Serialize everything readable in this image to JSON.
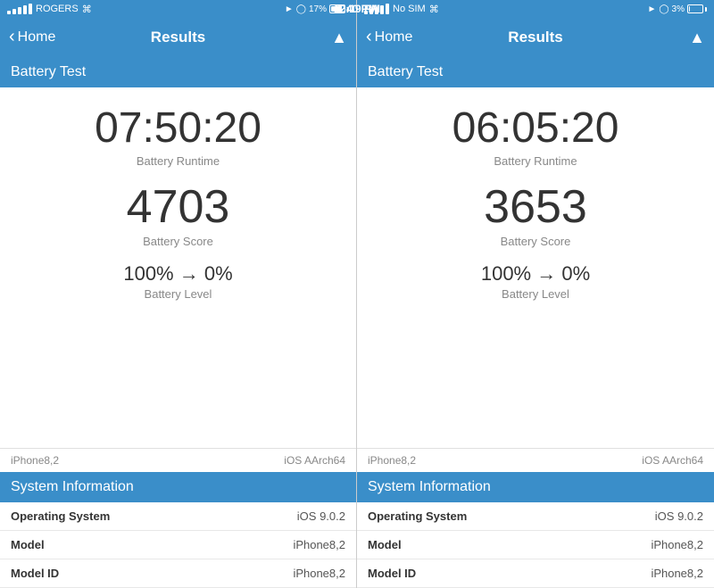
{
  "panels": [
    {
      "id": "panel-left",
      "statusBar": {
        "carrier": "ROGERS",
        "wifi": true,
        "time": "1:40 PM",
        "location": true,
        "bluetooth": true,
        "battery_percent": "17%",
        "battery_fill_width": "17%"
      },
      "nav": {
        "back_label": "Home",
        "title": "Results"
      },
      "section_title": "Battery Test",
      "runtime": "07:50:20",
      "runtime_label": "Battery Runtime",
      "score": "4703",
      "score_label": "Battery Score",
      "battery_level": "100% → 0%",
      "battery_level_label": "Battery Level",
      "footer_left": "iPhone8,2",
      "footer_right": "iOS AArch64",
      "system_info_title": "System Information",
      "info_rows": [
        {
          "label": "Operating System",
          "value": "iOS 9.0.2"
        },
        {
          "label": "Model",
          "value": "iPhone8,2"
        },
        {
          "label": "Model ID",
          "value": "iPhone8,2"
        }
      ]
    },
    {
      "id": "panel-right",
      "statusBar": {
        "carrier": "No SIM",
        "wifi": true,
        "time": "12:19 PM",
        "location": true,
        "bluetooth": true,
        "battery_percent": "3%",
        "battery_fill_width": "3%"
      },
      "nav": {
        "back_label": "Home",
        "title": "Results"
      },
      "section_title": "Battery Test",
      "runtime": "06:05:20",
      "runtime_label": "Battery Runtime",
      "score": "3653",
      "score_label": "Battery Score",
      "battery_level": "100% → 0%",
      "battery_level_label": "Battery Level",
      "footer_left": "iPhone8,2",
      "footer_right": "iOS AArch64",
      "system_info_title": "System Information",
      "info_rows": [
        {
          "label": "Operating System",
          "value": "iOS 9.0.2"
        },
        {
          "label": "Model",
          "value": "iPhone8,2"
        },
        {
          "label": "Model ID",
          "value": "iPhone8,2"
        }
      ]
    }
  ]
}
